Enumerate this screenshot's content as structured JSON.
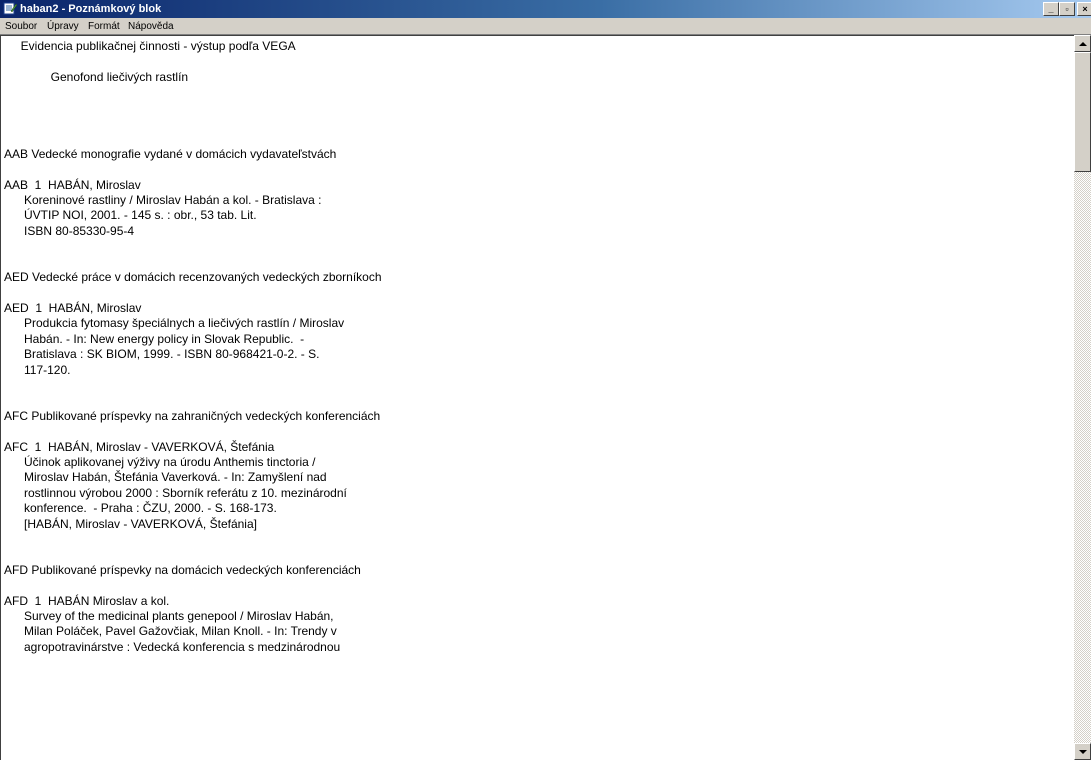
{
  "window": {
    "title": "haban2 - Poznámkový blok",
    "minimize_glyph": "_",
    "maximize_glyph": "▫",
    "close_glyph": "×",
    "icon": "notepad-icon"
  },
  "menu": {
    "items": [
      {
        "label": "Soubor"
      },
      {
        "label": "Úpravy"
      },
      {
        "label": "Formát"
      },
      {
        "label": "Nápověda"
      }
    ]
  },
  "document": {
    "text": "     Evidencia publikačnej činnosti - výstup podľa VEGA\n\n              Genofond liečivých rastlín\n\n\n\n\nAAB Vedecké monografie vydané v domácich vydavateľstvách\n\nAAB  1  HABÁN, Miroslav\n      Koreninové rastliny / Miroslav Habán a kol. - Bratislava :\n      ÚVTIP NOI, 2001. - 145 s. : obr., 53 tab. Lit.\n      ISBN 80-85330-95-4\n\n\nAED Vedecké práce v domácich recenzovaných vedeckých zborníkoch\n\nAED  1  HABÁN, Miroslav\n      Produkcia fytomasy špeciálnych a liečivých rastlín / Miroslav\n      Habán. - In: New energy policy in Slovak Republic.  -\n      Bratislava : SK BIOM, 1999. - ISBN 80-968421-0-2. - S.\n      117-120.\n\n\nAFC Publikované príspevky na zahraničných vedeckých konferenciách\n\nAFC  1  HABÁN, Miroslav - VAVERKOVÁ, Štefánia\n      Účinok aplikovanej výživy na úrodu Anthemis tinctoria /\n      Miroslav Habán, Štefánia Vaverková. - In: Zamyšlení nad\n      rostlinnou výrobou 2000 : Sborník referátu z 10. mezinárodní\n      konference.  - Praha : ČZU, 2000. - S. 168-173.\n      [HABÁN, Miroslav - VAVERKOVÁ, Štefánia]\n\n\nAFD Publikované príspevky na domácich vedeckých konferenciách\n\nAFD  1  HABÁN Miroslav a kol.\n      Survey of the medicinal plants genepool / Miroslav Habán,\n      Milan Poláček, Pavel Gažovčiak, Milan Knoll. - In: Trendy v\n      agropotravinárstve : Vedecká konferencia s medzinárodnou"
  },
  "colors": {
    "titlebar_start": "#0a246a",
    "titlebar_end": "#a6caf0",
    "chrome": "#d4d0c8",
    "editor_bg": "#ffffff"
  }
}
